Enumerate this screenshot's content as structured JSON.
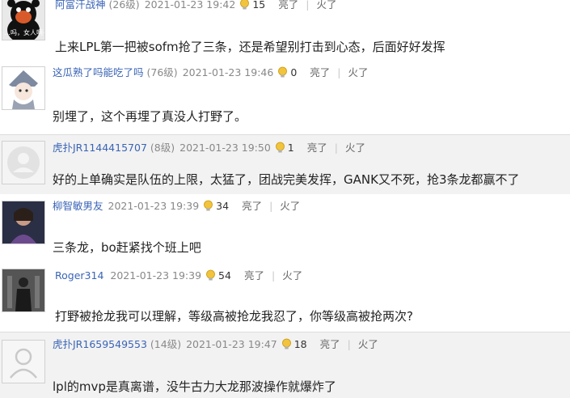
{
  "comments": [
    {
      "username": "阿富汗战神",
      "level": "(26级)",
      "time": "2021-01-23 19:42",
      "likes": "15",
      "like_label": "亮了",
      "fire_label": "火了",
      "text": "上来LPL第一把被sofm抢了三条，还是希望别打击到心态，后面好好发挥",
      "avatar_caption": "…吗，女人啊~"
    },
    {
      "username": "这瓜熟了吗能吃了吗",
      "level": "(76级)",
      "time": "2021-01-23 19:46",
      "likes": "0",
      "like_label": "亮了",
      "fire_label": "火了",
      "text": "别埋了，这个再埋了真没人打野了。"
    },
    {
      "username": "虎扑JR1144415707",
      "level": "(8级)",
      "time": "2021-01-23 19:50",
      "likes": "1",
      "like_label": "亮了",
      "fire_label": "火了",
      "text": "好的上单确实是队伍的上限，太猛了，团战完美发挥，GANK又不死，抢3条龙都赢不了"
    },
    {
      "username": "柳智敏男友",
      "level": "",
      "time": "2021-01-23 19:39",
      "likes": "34",
      "like_label": "亮了",
      "fire_label": "火了",
      "text": "三条龙，bo赶紧找个班上吧"
    },
    {
      "username": "Roger314",
      "level": "",
      "time": "2021-01-23 19:39",
      "likes": "54",
      "like_label": "亮了",
      "fire_label": "火了",
      "text": "打野被抢龙我可以理解，等级高被抢龙我忍了，你等级高被抢两次?"
    },
    {
      "username": "虎扑JR1659549553",
      "level": "(14级)",
      "time": "2021-01-23 19:47",
      "likes": "18",
      "like_label": "亮了",
      "fire_label": "火了",
      "text": "lpl的mvp是真离谱，没牛古力大龙那波操作就爆炸了"
    }
  ],
  "colors": {
    "username": "#3a64b6",
    "meta": "#888888",
    "alt_row": "#f2f2f2",
    "divider": "#dcdcdc"
  }
}
